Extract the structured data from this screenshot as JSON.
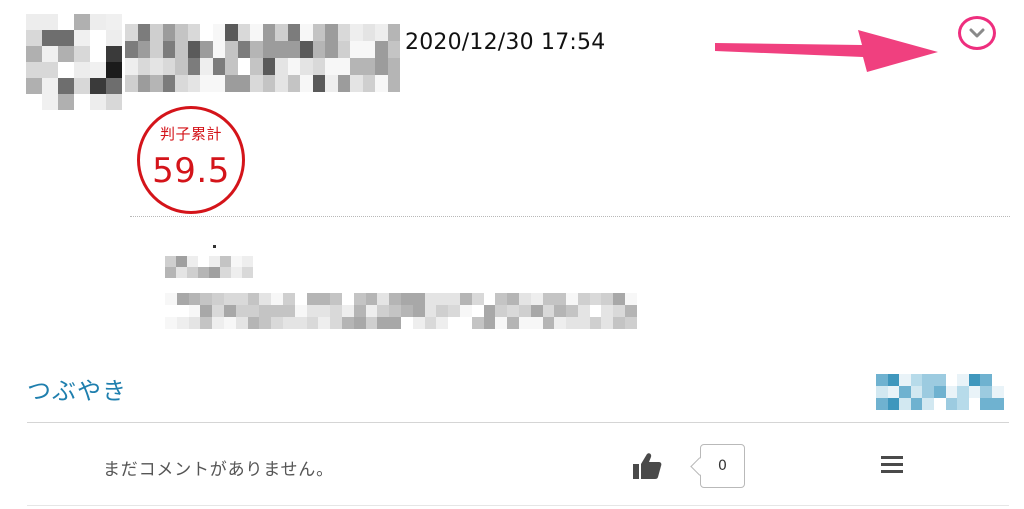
{
  "post": {
    "timestamp": "2020/12/30 17:54"
  },
  "stamp": {
    "label": "判子累計",
    "value": "59.5"
  },
  "section": {
    "title": "つぶやき"
  },
  "comments": {
    "empty_text": "まだコメントがありません。",
    "like_count": "0"
  },
  "colors": {
    "arrow_accent": "#f0407f",
    "toggle_ring": "#ee2e7e",
    "stamp_red": "#d4141a",
    "link_blue": "#1f7fae"
  },
  "icons": {
    "menu_toggle": "chevron-down-icon",
    "like": "thumbs-up-icon",
    "more": "hamburger-menu-icon",
    "annotation": "pink-arrow-icon"
  }
}
